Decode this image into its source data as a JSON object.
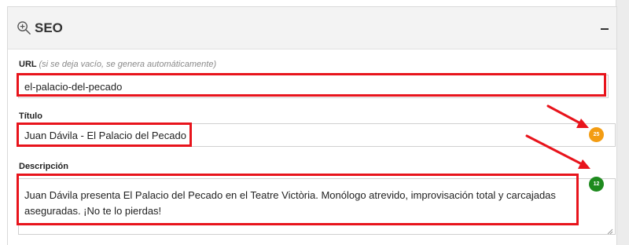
{
  "panel": {
    "title": "SEO",
    "icon": "zoom-in-icon",
    "collapse_symbol": "–"
  },
  "fields": {
    "url": {
      "label": "URL",
      "hint": "(si se deja vacío, se genera automáticamente)",
      "value": "el-palacio-del-pecado"
    },
    "title": {
      "label": "Título",
      "value": "Juan Dávila - El Palacio del Pecado",
      "counter": "25",
      "counter_color": "#f39c12"
    },
    "description": {
      "label": "Descripción",
      "value": "Juan Dávila presenta El Palacio del Pecado en el Teatre Victòria. Monólogo atrevido, improvisación total y carcajadas aseguradas. ¡No te lo pierdas!",
      "counter": "12",
      "counter_color": "#1e8a1e"
    }
  },
  "annotations": {
    "color": "#e8141c"
  }
}
